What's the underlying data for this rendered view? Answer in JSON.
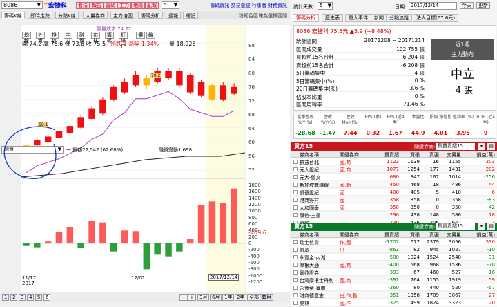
{
  "toolbar": {
    "stock_code": "8086",
    "stock_name": "宏捷科",
    "red_buttons": [
      "看法",
      "報告",
      "籌碼",
      "主力",
      "地緣",
      "亂報"
    ],
    "combo_value": "5",
    "links": "籌碼資訊 交易量統 行事曆 財務資訊"
  },
  "tabs": [
    "籌碼K線",
    "即時走勢",
    "分點K線",
    "大量券商",
    "主力培圍",
    "籌碼分析",
    "週報",
    "運記"
  ],
  "active_tab": 0,
  "subheader": "粉紅色區塊為選擇區間",
  "chart": {
    "legend_line": "籌量成本 74.72",
    "small_buttons": [
      "均線",
      "外資",
      "投信",
      "主力",
      "融資",
      "布林",
      "籌碼",
      "紅綠柱",
      "價",
      "線"
    ],
    "ohlc": "開 74.2  高 76.6  低 73.6  收 75.5",
    "change": "漲跌 1  漲幅 1.34%",
    "volume": "量 18,926",
    "price_ticks": [
      "88",
      "84",
      "80",
      "76",
      "72",
      "68",
      "64",
      "60",
      "56",
      "52"
    ],
    "margin_select": "融資",
    "margin_text": "一 餘額22,542 (62.68%)",
    "margin_change": "融資變動1,698",
    "lower_ticks": [
      "1800",
      "1600",
      "1400",
      "1200",
      "1000",
      "800",
      "600",
      "400",
      "200",
      "0",
      "-200",
      "-400",
      "-600",
      "-800",
      "-1000",
      "-1200"
    ],
    "current_value": "-469.6",
    "date_left": "11/17",
    "year_left": "2017",
    "date_mid": "12/01",
    "date_right": "2017/12/14",
    "low_label": "60.1",
    "high_label": "70.2"
  },
  "chart_data": {
    "type": "bar",
    "candles": [
      {
        "o": 57,
        "c": 59,
        "h": 59.5,
        "l": 56.5,
        "color": "orange"
      },
      {
        "o": 59,
        "c": 60.5,
        "h": 61,
        "l": 58.5,
        "color": "red"
      },
      {
        "o": 60,
        "c": 61.5,
        "h": 62,
        "l": 59.5,
        "color": "red"
      },
      {
        "o": 61,
        "c": 63,
        "h": 63.5,
        "l": 60.5,
        "color": "red"
      },
      {
        "o": 62.5,
        "c": 64.5,
        "h": 65,
        "l": 62,
        "color": "red"
      },
      {
        "o": 64,
        "c": 67,
        "h": 67.5,
        "l": 63.5,
        "color": "red"
      },
      {
        "o": 66.5,
        "c": 69.5,
        "h": 70,
        "l": 66,
        "color": "red"
      },
      {
        "o": 68,
        "c": 72,
        "h": 72.5,
        "l": 67.5,
        "color": "red"
      },
      {
        "o": 72,
        "c": 75.5,
        "h": 76,
        "l": 71.5,
        "color": "red"
      },
      {
        "o": 74,
        "c": 77,
        "h": 78,
        "l": 73.5,
        "color": "red"
      },
      {
        "o": 76,
        "c": 79,
        "h": 80,
        "l": 75.5,
        "color": "red"
      },
      {
        "o": 76,
        "c": 78,
        "h": 79,
        "l": 75,
        "color": "orange"
      },
      {
        "o": 77,
        "c": 80,
        "h": 81,
        "l": 76.5,
        "color": "red"
      },
      {
        "o": 78,
        "c": 80,
        "h": 81,
        "l": 77.5,
        "color": "red"
      },
      {
        "o": 76,
        "c": 80,
        "h": 81,
        "l": 75.5,
        "color": "red"
      },
      {
        "o": 74,
        "c": 79,
        "h": 79.5,
        "l": 73.5,
        "color": "red"
      },
      {
        "o": 73,
        "c": 77,
        "h": 77.5,
        "l": 72.5,
        "color": "red"
      },
      {
        "o": 72,
        "c": 76,
        "h": 76.5,
        "l": 71.5,
        "color": "orange"
      },
      {
        "o": 72,
        "c": 76,
        "h": 77,
        "l": 71.5,
        "color": "red"
      },
      {
        "o": 73.6,
        "c": 75.5,
        "h": 76.6,
        "l": 73.2,
        "color": "red"
      }
    ],
    "margin_changes": [
      -80,
      -120,
      60,
      350,
      500,
      -150,
      700,
      650,
      -250,
      400,
      380,
      -800,
      -350,
      -400,
      -250,
      150,
      1200,
      1300,
      1250,
      1698
    ],
    "price_ylim": [
      52,
      88
    ],
    "margin_ylim": [
      -1200,
      1800
    ]
  },
  "bottom_bar": {
    "pages": [
      "1",
      "2",
      "3",
      "4",
      "5",
      "6"
    ],
    "periods": [
      "3月",
      "6月",
      "1年",
      "2年",
      "全部"
    ],
    "confirm": "套用"
  },
  "right": {
    "stats_label": "統計天數:",
    "stats_days": "5",
    "date_label": "日期:",
    "date_value": "2017/12/14",
    "today_btn": "今天",
    "refresh_btn": "更新",
    "tabs": [
      "籌碼分析",
      "歷史表",
      "重大事件",
      "新聞",
      "分點追蹤",
      "法人目標(67.6元)"
    ],
    "stock_line": "8086  宏捷科   75.5元  ▲5.9 (+8.48%)",
    "summary_rows": [
      {
        "label": "統計區間",
        "value": "20171208 ~ 20171214"
      },
      {
        "label": "區間成交量",
        "value": "102,755 張"
      },
      {
        "label": "買超前15名合計",
        "value": "6,204 張"
      },
      {
        "label": "賣超前15名合計",
        "value": "-6,208 張"
      },
      {
        "label": "5日籌碼集中",
        "value": "-4 張"
      },
      {
        "label": "5日籌碼集中(%)",
        "value": "0 %"
      },
      {
        "label": "20日籌碼集中(%)",
        "value": "3.6 %"
      },
      {
        "label": "佔股本比重",
        "value": "0 %"
      },
      {
        "label": "區間周轉率",
        "value": "71.46 %"
      }
    ],
    "trend_title": "近1週",
    "trend_sub": "主力動向",
    "trend_state": "中立",
    "trend_value": "-4 張",
    "metrics_headers": [
      "當季營收 YoY(%)",
      "營收 YoY(%)",
      "營收 MoM(%)",
      "EPS (季)",
      "EPS (近4季)",
      "本益比",
      "股價 淨值比",
      "殖利率 (%)",
      "ROE (近4季)"
    ],
    "metrics_values": [
      "-28.68",
      "-1.47",
      "7.44",
      "0.32",
      "1.67",
      "44.9",
      "4.01",
      "3.95",
      "9"
    ],
    "buy_title": "買方15",
    "buy_label": "關鍵券商:",
    "buy_select": "集買賣超15",
    "col_headers": [
      "券商名稱",
      "關鍵券商",
      "買賣超",
      "買張",
      "賣張",
      "交易量",
      "損益(萬)"
    ],
    "buy_rows": [
      [
        "群益台北",
        "國,商",
        "1123",
        "1139",
        "16",
        "1155",
        "303"
      ],
      [
        "元大證紀",
        "國,商",
        "1077",
        "1254",
        "177",
        "1431",
        "202"
      ],
      [
        "元大-營文",
        "",
        "680",
        "847",
        "167",
        "1014",
        "-256"
      ],
      [
        "新加坡商瑞銀",
        "國,動",
        "450",
        "468",
        "18",
        "486",
        "44"
      ],
      [
        "凱基證紀",
        "國",
        "400",
        "405",
        "5",
        "410",
        "6"
      ],
      [
        "港商野村",
        "國",
        "358",
        "358",
        "0",
        "358",
        "-83"
      ],
      [
        "大和國泰",
        "國",
        "350",
        "350",
        "0",
        "350",
        "-42"
      ],
      [
        "康信-三重",
        "",
        "290",
        "438",
        "148",
        "586",
        "18"
      ],
      [
        "康和",
        "",
        "230",
        "436",
        "206",
        "642",
        "3"
      ]
    ],
    "sell_title": "賣方15",
    "sell_label": "關鍵券商:",
    "sell_select": "集賣賣超15",
    "sell_rows": [
      [
        "瑞士信貸",
        "作,國",
        "-1702",
        "677",
        "2379",
        "3056",
        "530"
      ],
      [
        "凱基",
        "出",
        "-863",
        "82",
        "945",
        "1027",
        "-10"
      ],
      [
        "永豐金-內湖",
        "",
        "-500",
        "1024",
        "1524",
        "2548",
        "-31"
      ],
      [
        "摩根大通",
        "國,商",
        "-400",
        "568",
        "968",
        "1536",
        "-70"
      ],
      [
        "嘉鼎證券",
        "",
        "-393",
        "67",
        "460",
        "527",
        "-16"
      ],
      [
        "台灣摩根士丹利",
        "國,商",
        "-391",
        "764",
        "1155",
        "1919",
        "59"
      ],
      [
        "永豐金-臺南",
        "",
        "-360",
        "80",
        "440",
        "520",
        "-57"
      ],
      [
        "港商德意志",
        "出,作,動",
        "-351",
        "1358",
        "1709",
        "3067",
        "27"
      ],
      [
        "美林",
        "國,作",
        "-325",
        "1499",
        "1824",
        "3323",
        "20"
      ]
    ],
    "colors": {
      "red_header": "#c8171e",
      "green_header": "#0a7a2a",
      "accent": "#e00000"
    }
  }
}
